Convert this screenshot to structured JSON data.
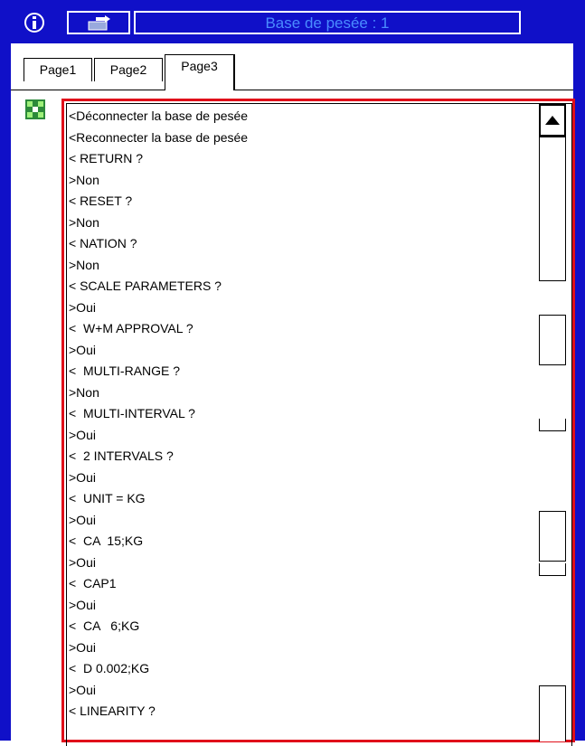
{
  "window": {
    "title": "Base de pesée : 1",
    "info_icon": "info-icon",
    "file_icon": "file-transfer-icon",
    "frame_color": "#1010c8",
    "title_color": "#4a8cff"
  },
  "tabs": [
    {
      "label": "Page1",
      "active": false
    },
    {
      "label": "Page2",
      "active": false
    },
    {
      "label": "Page3",
      "active": true
    }
  ],
  "content": {
    "side_icon": "scale-connector-icon",
    "border_color": "#e0101a",
    "entries": [
      "<Déconnecter la base de pesée",
      "<Reconnecter la base de pesée",
      "< RETURN ?",
      ">Non",
      "< RESET ?",
      ">Non",
      "< NATION ?",
      ">Non",
      "< SCALE PARAMETERS ?",
      ">Oui",
      "<  W+M APPROVAL ?",
      ">Oui",
      "<  MULTI-RANGE ?",
      ">Non",
      "<  MULTI-INTERVAL ?",
      ">Oui",
      "<  2 INTERVALS ?",
      ">Oui",
      "<  UNIT = KG",
      ">Oui",
      "<  CA  15;KG",
      ">Oui",
      "<  CAP1",
      ">Oui",
      "<  CA   6;KG",
      ">Oui",
      "<  D 0.002;KG",
      ">Oui",
      "< LINEARITY ?"
    ]
  },
  "scrollbar": {
    "up_icon": "scroll-up-arrow-icon"
  }
}
